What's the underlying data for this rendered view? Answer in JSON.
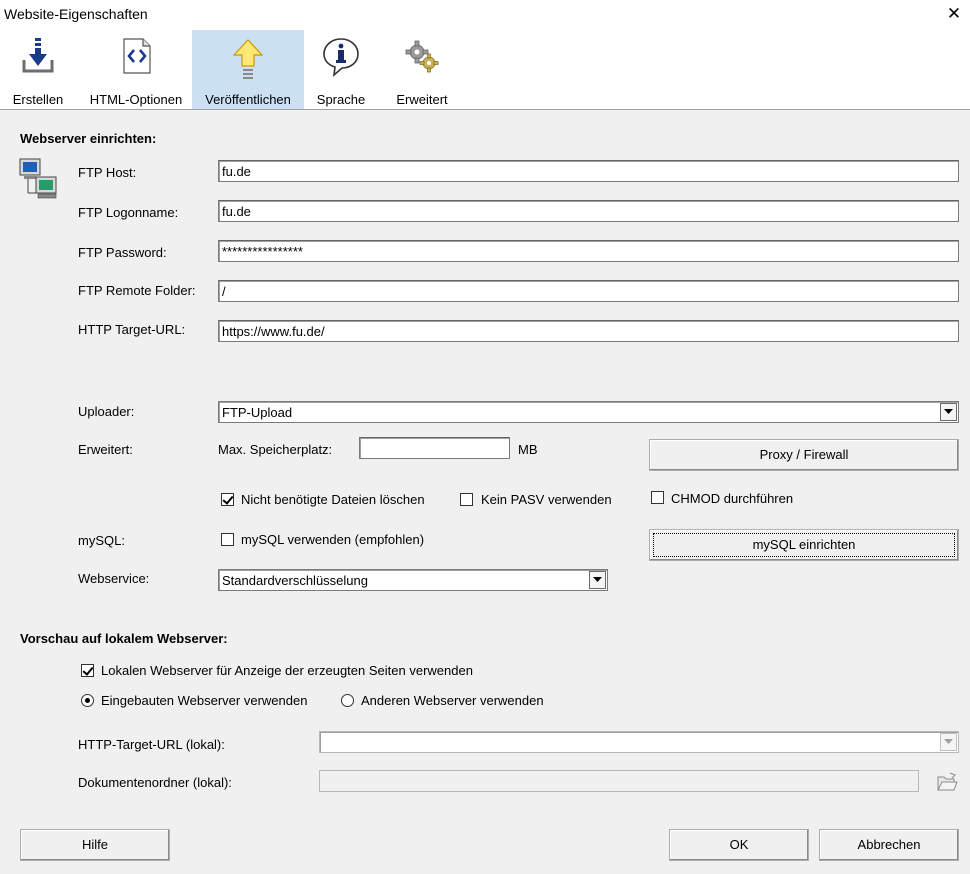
{
  "window": {
    "title": "Website-Eigenschaften",
    "close_glyph": "✕"
  },
  "toolbar": {
    "items": [
      {
        "label": "Erstellen",
        "icon": "download-icon",
        "active": false
      },
      {
        "label": "HTML-Optionen",
        "icon": "code-document-icon",
        "active": false
      },
      {
        "label": "Veröffentlichen",
        "icon": "upload-arrow-icon",
        "active": true
      },
      {
        "label": "Sprache",
        "icon": "info-bubble-icon",
        "active": false
      },
      {
        "label": "Erweitert",
        "icon": "gears-icon",
        "active": false
      }
    ]
  },
  "webserver": {
    "title": "Webserver einrichten:",
    "ftp_host_label": "FTP Host:",
    "ftp_host_value": "fu.de",
    "ftp_logon_label": "FTP Logonname:",
    "ftp_logon_value": "fu.de",
    "ftp_password_label": "FTP Password:",
    "ftp_password_value": "****************",
    "ftp_folder_label": "FTP Remote Folder:",
    "ftp_folder_value": "/",
    "http_url_label": "HTTP Target-URL:",
    "http_url_value": "https://www.fu.de/",
    "uploader_label": "Uploader:",
    "uploader_value": "FTP-Upload",
    "erweitert_label": "Erweitert:",
    "max_storage_label": "Max. Speicherplatz:",
    "max_storage_value": "",
    "max_storage_unit": "MB",
    "proxy_button": "Proxy / Firewall",
    "delete_files_label": "Nicht benötigte Dateien löschen",
    "delete_files_checked": true,
    "pasv_label": "Kein PASV verwenden",
    "pasv_checked": false,
    "chmod_label": "CHMOD durchführen",
    "chmod_checked": false,
    "mysql_label": "mySQL:",
    "mysql_use_label": "mySQL verwenden (empfohlen)",
    "mysql_use_checked": false,
    "mysql_button": "mySQL einrichten",
    "webservice_label": "Webservice:",
    "webservice_value": "Standardverschlüsselung"
  },
  "preview": {
    "title": "Vorschau auf lokalem Webserver:",
    "use_local_label": "Lokalen Webserver für Anzeige der erzeugten Seiten verwenden",
    "use_local_checked": true,
    "builtin_label": "Eingebauten Webserver verwenden",
    "builtin_selected": true,
    "other_label": "Anderen Webserver verwenden",
    "other_selected": false,
    "target_url_label": "HTTP-Target-URL (lokal):",
    "target_url_value": "",
    "doc_folder_label": "Dokumentenordner (lokal):",
    "doc_folder_value": ""
  },
  "footer": {
    "help_button": "Hilfe",
    "ok_button": "OK",
    "cancel_button": "Abbrechen"
  }
}
